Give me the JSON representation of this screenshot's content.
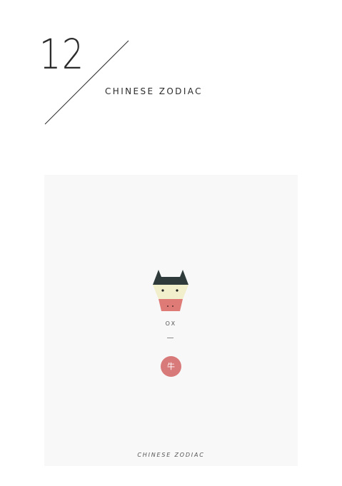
{
  "header": {
    "number": "12",
    "title": "CHINESE ZODIAC"
  },
  "card": {
    "icon": "ox-head-icon",
    "animal_name": "OX",
    "hanzi": "牛",
    "footer": "CHINESE ZODIAC"
  },
  "colors": {
    "horns": "#2f3b3b",
    "face": "#f1efcc",
    "muzzle": "#df7b77",
    "badge": "#d97a7a",
    "card_background": "#f8f8f8"
  }
}
